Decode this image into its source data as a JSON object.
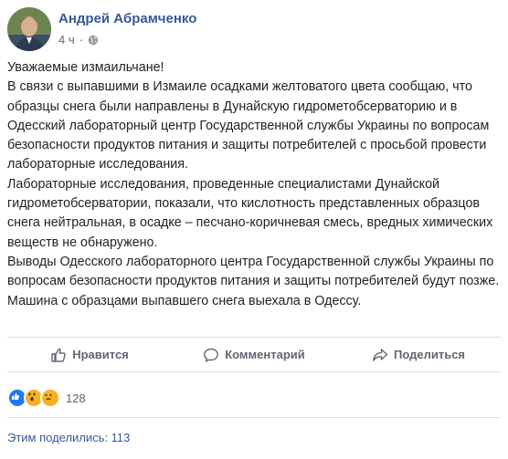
{
  "post": {
    "author": "Андрей Абрамченко",
    "time": "4 ч",
    "separator": "·",
    "paragraphs": [
      "Уважаемые измаильчане!",
      "В связи с выпавшими в Измаиле осадками желтоватого цвета сообщаю, что образцы снега были направлены в Дунайскую гидрометобсерваторию и в Одесский лабораторный центр Государственной службы Украины по вопросам безопасности продуктов питания и защиты потребителей с просьбой провести лабораторные исследования.",
      "Лабораторные исследования, проведенные специалистами Дунайской гидрометобсерватории, показали, что кислотность представленных образцов снега нейтральная, в осадке – песчано-коричневая смесь, вредных химических веществ не обнаружено.",
      "Выводы Одесского лабораторного центра Государственной службы Украины по вопросам безопасности продуктов питания и защиты потребителей будут позже. Машина с образцами выпавшего снега выехала в Одессу."
    ]
  },
  "actions": {
    "like": "Нравится",
    "comment": "Комментарий",
    "share": "Поделиться"
  },
  "reactions": {
    "icons": [
      "like-icon",
      "wow-icon",
      "sad-icon"
    ],
    "count": "128"
  },
  "shares_text": "Этим поделились: 113",
  "colors": {
    "link": "#385898",
    "text": "#1d2129",
    "muted": "#606770",
    "divider": "#dadde1",
    "like_blue": "#2078f4",
    "emoji_yellow": "#f7b125"
  }
}
